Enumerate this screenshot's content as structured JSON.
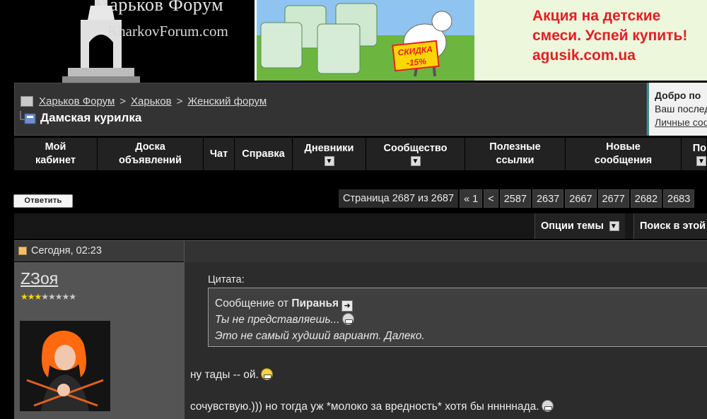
{
  "header": {
    "logo_title": "Харьков Форум",
    "logo_domain": "KharkovForum.com",
    "ad": {
      "lines": [
        "Акция на детские",
        "смеси. Успей купить!",
        "agusik.com.ua"
      ],
      "discount_line1": "СКИДКА",
      "discount_line2": "-15%",
      "accent_color": "#e31e24"
    }
  },
  "breadcrumb": {
    "items": [
      "Харьков Форум",
      "Харьков",
      "Женский форум"
    ],
    "separator": ">",
    "current": "Дамская курилка"
  },
  "welcome": {
    "title": "Добро по",
    "subtitle": "Ваш послед",
    "link": "Личные соо"
  },
  "nav": {
    "items": [
      {
        "line1": "Мой",
        "line2": "кабинет"
      },
      {
        "line1": "Доска",
        "line2": "объявлений"
      },
      {
        "line1": "Чат"
      },
      {
        "line1": "Справка"
      },
      {
        "line1": "Дневники",
        "arrow": true
      },
      {
        "line1": "Сообщество",
        "arrow": true
      },
      {
        "line1": "Полезные",
        "line2": "ссылки"
      },
      {
        "line1": "Новые",
        "line2": "сообщения"
      },
      {
        "line1": "По",
        "arrow": true
      }
    ]
  },
  "toolbar": {
    "reply_label": "Ответить",
    "page_label": "Страница 2687 из 2687",
    "pages": [
      "« 1",
      "<",
      "2587",
      "2637",
      "2667",
      "2677",
      "2682",
      "2683"
    ],
    "thread_options": "Опции темы",
    "search_thread": "Поиск в этой"
  },
  "post": {
    "date": "Сегодня, 02:23",
    "username": "ZЗоя",
    "reputation_on": "★★★",
    "reputation_off": "★★★★★",
    "quote_label": "Цитата:",
    "quote_prefix": "Сообщение от ",
    "quote_author": "Пиранья",
    "quote_lines": [
      "Ты не представляешь...",
      "Это не самый худший вариант. Далеко."
    ],
    "text_lines": [
      "ну тады -- ой.",
      "сочувствую.))) но тогда уж *молоко за вредность* хотя бы нннннада."
    ]
  }
}
